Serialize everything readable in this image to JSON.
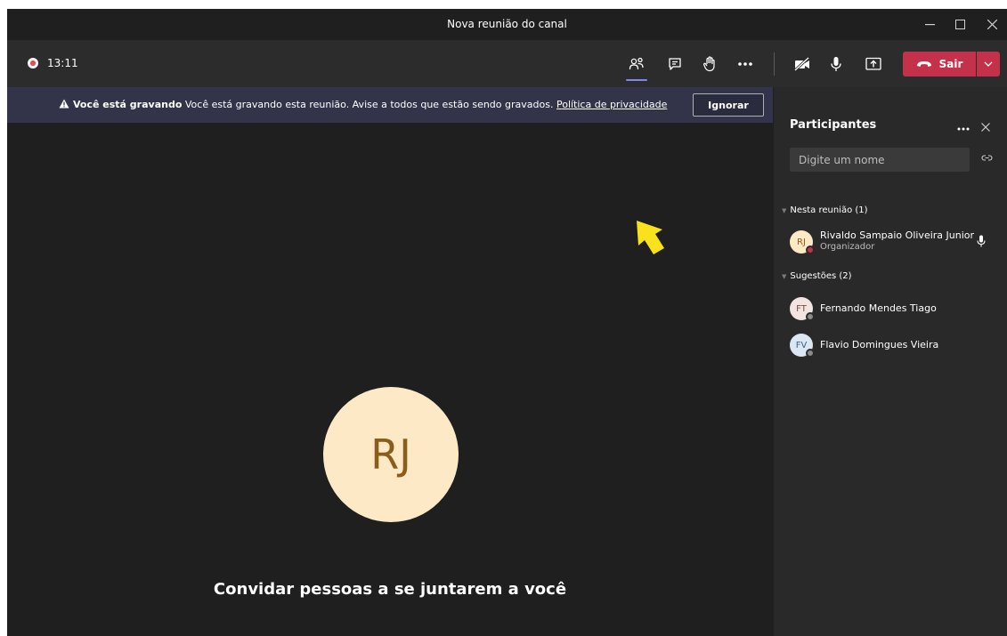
{
  "window": {
    "title": "Nova reunião do canal",
    "controls": [
      "minimize-icon",
      "maximize-icon",
      "close-icon"
    ]
  },
  "toolbar": {
    "timer": "13:11",
    "icons": [
      "participants-icon",
      "chat-icon",
      "raise-hand-icon",
      "more-icon",
      "camera-off-icon",
      "mic-icon",
      "share-screen-icon"
    ],
    "leave_label": "Sair",
    "colors": {
      "leave": "#c4314b",
      "accent": "#7f85f5",
      "record": "#e74856"
    }
  },
  "banner": {
    "title": "Você está gravando",
    "message": "Você está gravando esta reunião. Avise a todos que estão sendo gravados.",
    "link": "Política de privacidade",
    "button": "Ignorar"
  },
  "stage": {
    "avatar_initials": "RJ",
    "invite_text": "Convidar pessoas a se juntarem a você"
  },
  "panel": {
    "title": "Participantes",
    "search_placeholder": "Digite um nome",
    "in_meeting": {
      "label": "Nesta reunião (1)",
      "people": [
        {
          "initials": "RJ",
          "name": "Rivaldo Sampaio Oliveira Junior",
          "role": "Organizador"
        }
      ]
    },
    "suggestions": {
      "label": "Sugestões (2)",
      "people": [
        {
          "initials": "FT",
          "name": "Fernando Mendes Tiago"
        },
        {
          "initials": "FV",
          "name": "Flavio Domingues Vieira"
        }
      ]
    }
  }
}
